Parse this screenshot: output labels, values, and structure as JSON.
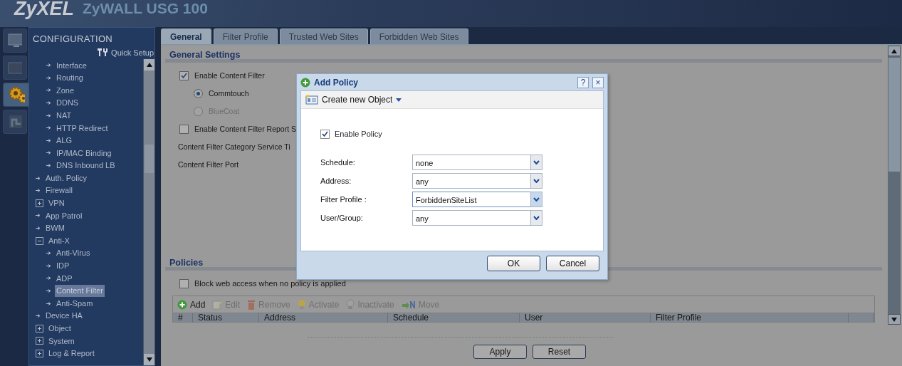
{
  "header": {
    "brand": "ZyXEL",
    "product": "ZyWALL USG 100"
  },
  "icon_strip": [
    {
      "kind": "monitor",
      "selected": false
    },
    {
      "kind": "screen",
      "selected": false
    },
    {
      "kind": "gears",
      "selected": true
    },
    {
      "kind": "chart",
      "selected": false
    }
  ],
  "sidebar": {
    "title": "CONFIGURATION",
    "quick_setup": "Quick Setup",
    "continued_children": [
      {
        "label": "Interface",
        "selected": false
      },
      {
        "label": "Routing",
        "selected": false
      },
      {
        "label": "Zone",
        "selected": false
      },
      {
        "label": "DDNS",
        "selected": false
      },
      {
        "label": "NAT",
        "selected": false
      },
      {
        "label": "HTTP Redirect",
        "selected": false
      },
      {
        "label": "ALG",
        "selected": false
      },
      {
        "label": "IP/MAC Binding",
        "selected": false
      },
      {
        "label": "DNS Inbound LB",
        "selected": false
      }
    ],
    "items": [
      {
        "label": "Auth. Policy",
        "selected": false
      },
      {
        "label": "Firewall",
        "selected": false
      },
      {
        "label": "VPN",
        "selected": false,
        "expanded": false
      },
      {
        "label": "App Patrol",
        "selected": false
      },
      {
        "label": "BWM",
        "selected": false
      },
      {
        "label": "Anti-X",
        "selected": false,
        "expanded": true,
        "children": [
          {
            "label": "Anti-Virus",
            "selected": false
          },
          {
            "label": "IDP",
            "selected": false
          },
          {
            "label": "ADP",
            "selected": false
          },
          {
            "label": "Content Filter",
            "selected": true
          },
          {
            "label": "Anti-Spam",
            "selected": false
          }
        ]
      },
      {
        "label": "Device HA",
        "selected": false
      },
      {
        "label": "Object",
        "selected": false,
        "expanded": false
      },
      {
        "label": "System",
        "selected": false,
        "expanded": false
      },
      {
        "label": "Log & Report",
        "selected": false,
        "expanded": false
      }
    ]
  },
  "tabs": [
    {
      "label": "General",
      "selected": true
    },
    {
      "label": "Filter Profile",
      "selected": false
    },
    {
      "label": "Trusted Web Sites",
      "selected": false
    },
    {
      "label": "Forbidden Web Sites",
      "selected": false
    }
  ],
  "general_settings": {
    "title": "General Settings",
    "rows": [
      {
        "kind": "checkbox",
        "label": "Enable Content Filter",
        "checked": true
      },
      {
        "kind": "radio",
        "label": "Commtouch",
        "selected": true,
        "disabled": false
      },
      {
        "kind": "radio",
        "label": "BlueCoat",
        "selected": false,
        "disabled": true
      },
      {
        "kind": "checkbox",
        "label": "Enable Content Filter Report S",
        "checked": false
      },
      {
        "kind": "label",
        "label": "Content Filter Category Service Ti"
      },
      {
        "kind": "label",
        "label": "Content Filter Port"
      }
    ]
  },
  "policies": {
    "title": "Policies",
    "block_option": {
      "label": "Block web access when no policy is applied",
      "checked": false
    },
    "toolbar": [
      {
        "kind": "add",
        "label": "Add",
        "disabled": false
      },
      {
        "kind": "edit",
        "label": "Edit",
        "disabled": true
      },
      {
        "kind": "remove",
        "label": "Remove",
        "disabled": true
      },
      {
        "kind": "activate",
        "label": "Activate",
        "disabled": true
      },
      {
        "kind": "inactivate",
        "label": "Inactivate",
        "disabled": true
      },
      {
        "kind": "move",
        "label": "Move",
        "disabled": true
      }
    ],
    "columns": [
      "#",
      "Status",
      "Address",
      "Schedule",
      "User",
      "Filter Profile"
    ]
  },
  "buttons": [
    "Apply",
    "Reset"
  ],
  "dialog": {
    "title": "Add Policy",
    "help": "?",
    "close": "×",
    "create_object": "Create new Object",
    "enable_policy": {
      "label": "Enable Policy",
      "checked": true
    },
    "fields": [
      {
        "label": "Schedule:",
        "value": "none",
        "focused": false
      },
      {
        "label": "Address:",
        "value": "any",
        "focused": false
      },
      {
        "label": "Filter Profile :",
        "value": "ForbiddenSiteList",
        "focused": true
      },
      {
        "label": "User/Group:",
        "value": "any",
        "focused": false
      }
    ],
    "buttons": [
      "OK",
      "Cancel"
    ]
  }
}
